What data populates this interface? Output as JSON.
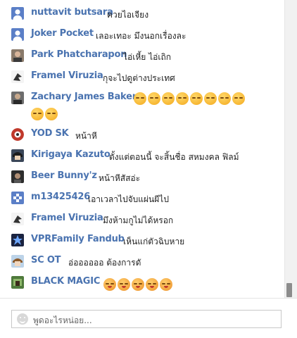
{
  "messages": [
    {
      "author": "nuttavit butsara",
      "text": "ควยไอเจียง",
      "avatar": "default-user-avatar",
      "emoji_count": 0
    },
    {
      "author": "Joker Pocket",
      "text": "เลอะเทอะ มึงนอกเรื่องละ",
      "avatar": "default-user-avatar",
      "emoji_count": 0
    },
    {
      "author": "Park Phatcharapon",
      "text": "ไอ่เหี้ย ไอ่เถิก",
      "avatar": "photo-avatar",
      "emoji_count": 0
    },
    {
      "author": "Framel Viruzia",
      "text": "กุจะไปดูต่างประเทศ",
      "avatar": "bird-avatar",
      "emoji_count": 0
    },
    {
      "author": "Zachary James Baker",
      "text": "",
      "avatar": "photo-avatar",
      "emoji_count": 10,
      "emoji_name": "unamused-emoji"
    },
    {
      "author": "YOD SK",
      "text": "หน้าหี",
      "avatar": "logo-avatar",
      "emoji_count": 0
    },
    {
      "author": "Kirigaya Kazuto",
      "text": "ตั้งแต่ตอนนี้ จะสิ้นชื่อ สหมงคล ฟิลม์",
      "avatar": "anime-avatar",
      "emoji_count": 0
    },
    {
      "author": "Beer Bunny'z",
      "text": "หน้าหีสัสอ่ะ",
      "avatar": "photo-avatar",
      "emoji_count": 0
    },
    {
      "author": "m13425426",
      "text": "เอาเวลาไปจับแผ่นผีไป",
      "avatar": "pattern-avatar",
      "emoji_count": 0
    },
    {
      "author": "Framel Viruzia",
      "text": "มึงห้ามกูไม่ได้หรอก",
      "avatar": "bird-avatar",
      "emoji_count": 0
    },
    {
      "author": "VPRFamily Fandub",
      "text": "เห็นแก่ตัวฉิบหาย",
      "avatar": "logo-avatar",
      "emoji_count": 0
    },
    {
      "author": "SC OT",
      "text": "อ่ออออออ ต้องการดั",
      "avatar": "anime-avatar",
      "emoji_count": 0
    },
    {
      "author": "BLACK MAGIC",
      "text": "",
      "avatar": "photo-avatar",
      "emoji_count": 5,
      "emoji_name": "pouting-emoji"
    }
  ],
  "composer": {
    "placeholder": "พูดอะไรหน่อย..."
  },
  "colors": {
    "author": "#4a73b0",
    "text": "#222222"
  }
}
